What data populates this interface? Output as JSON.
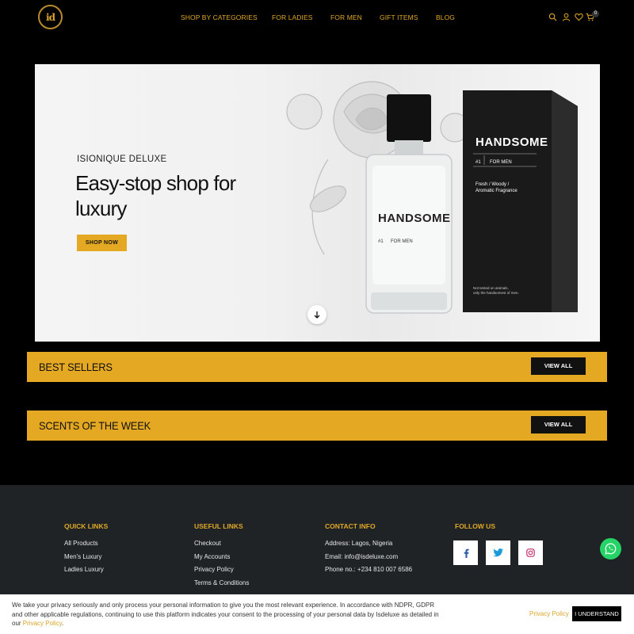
{
  "header": {
    "logo_text": "id",
    "nav": [
      {
        "label": "SHOP BY CATEGORIES"
      },
      {
        "label": "FOR LADIES"
      },
      {
        "label": "FOR MEN"
      },
      {
        "label": "GIFT ITEMS"
      },
      {
        "label": "BLOG"
      }
    ],
    "cart_count": "0",
    "icons": [
      "search-icon",
      "user-icon",
      "heart-icon",
      "cart-icon"
    ]
  },
  "hero": {
    "brand": "ISIONIQUE DELUXE",
    "title": "Easy-stop shop for luxury",
    "button_label": "SHOP NOW",
    "product": {
      "name": "HANDSOME",
      "number": "#1",
      "for": "FOR MEN",
      "notes_line1": "Fresh / Woody /",
      "notes_line2": "Aromatic Fragrance",
      "fine_print_line1": "Not tested on animals,",
      "fine_print_line2": "only the handsomest of men."
    }
  },
  "sections": [
    {
      "title": "BEST SELLERS",
      "button_label": "VIEW ALL"
    },
    {
      "title": "SCENTS OF THE WEEK",
      "button_label": "VIEW ALL"
    }
  ],
  "footer": {
    "quick_links": {
      "heading": "QUICK LINKS",
      "items": [
        "All Products",
        "Men's Luxury",
        "Ladies Luxury"
      ]
    },
    "useful_links": {
      "heading": "USEFUL LINKS",
      "items": [
        "Checkout",
        "My Accounts",
        "Privacy Policy",
        "Terms & Conditions"
      ]
    },
    "contact": {
      "heading": "CONTACT INFO",
      "items": [
        "Address: Lagos, Nigeria",
        "Email: info@isdeluxe.com",
        "Phone no.: +234 810 007 6586"
      ]
    },
    "follow": {
      "heading": "FOLLOW US",
      "icons": [
        "facebook-icon",
        "twitter-icon",
        "instagram-icon"
      ]
    }
  },
  "cookie": {
    "text": "We take your privacy seriously and only process your personal information to give you the most relevant experience. In accordance with NDPR, GDPR and other applicable regulations, continuing to use this platform indicates your consent to the processing of your personal data by Isdeluxe as detailed in our",
    "inline_link": "Privacy Policy",
    "policy_link": "Privacy Policy",
    "accept_label": "I UNDERSTAND"
  },
  "colors": {
    "accent": "#e5a823",
    "background": "#000000",
    "footer": "#1f2326",
    "whatsapp": "#25d366"
  }
}
